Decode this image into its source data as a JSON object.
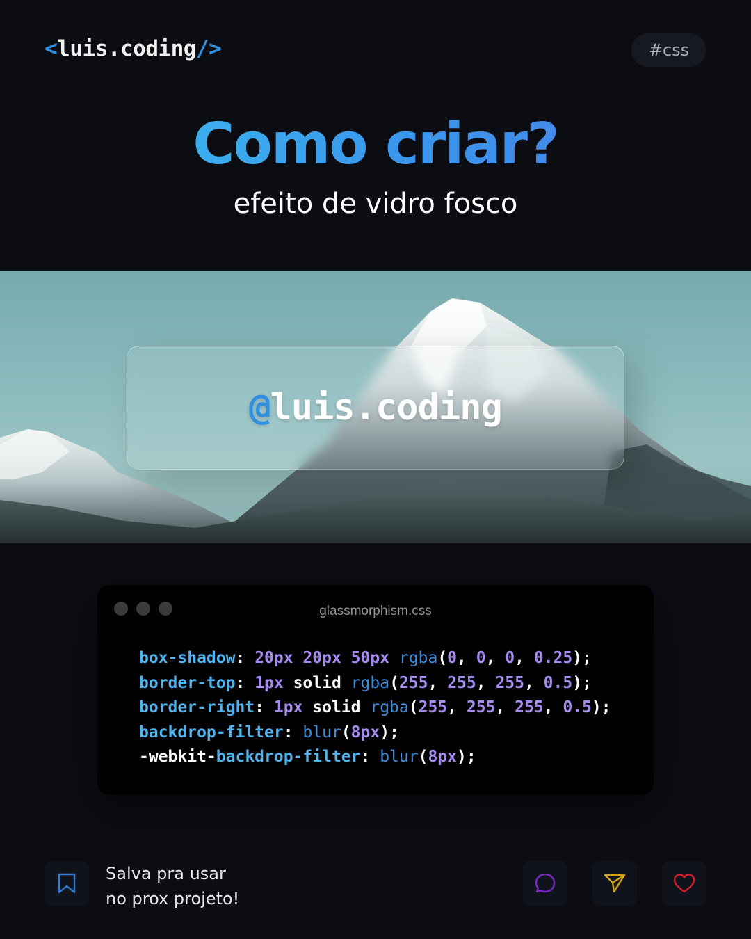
{
  "brand": {
    "open": "<",
    "name": "luis.coding",
    "slash": "/",
    "close": ">"
  },
  "tag": "#css",
  "headline": "Como criar?",
  "subtitle": "efeito de vidro fosco",
  "hero": {
    "at": "@",
    "handle": "luis.coding"
  },
  "code_window": {
    "filename": "glassmorphism.css",
    "lines": [
      [
        {
          "t": "box-shadow",
          "c": "prop"
        },
        {
          "t": ": ",
          "c": "plain"
        },
        {
          "t": "20px 20px 50px",
          "c": "num"
        },
        {
          "t": " ",
          "c": "plain"
        },
        {
          "t": "rgba",
          "c": "fn"
        },
        {
          "t": "(",
          "c": "plain"
        },
        {
          "t": "0",
          "c": "num"
        },
        {
          "t": ", ",
          "c": "plain"
        },
        {
          "t": "0",
          "c": "num"
        },
        {
          "t": ", ",
          "c": "plain"
        },
        {
          "t": "0",
          "c": "num"
        },
        {
          "t": ", ",
          "c": "plain"
        },
        {
          "t": "0.25",
          "c": "num"
        },
        {
          "t": ");",
          "c": "plain"
        }
      ],
      [
        {
          "t": "border-top",
          "c": "prop"
        },
        {
          "t": ": ",
          "c": "plain"
        },
        {
          "t": "1px",
          "c": "num"
        },
        {
          "t": " solid ",
          "c": "plain"
        },
        {
          "t": "rgba",
          "c": "fn"
        },
        {
          "t": "(",
          "c": "plain"
        },
        {
          "t": "255",
          "c": "num"
        },
        {
          "t": ", ",
          "c": "plain"
        },
        {
          "t": "255",
          "c": "num"
        },
        {
          "t": ", ",
          "c": "plain"
        },
        {
          "t": "255",
          "c": "num"
        },
        {
          "t": ", ",
          "c": "plain"
        },
        {
          "t": "0.5",
          "c": "num"
        },
        {
          "t": ");",
          "c": "plain"
        }
      ],
      [
        {
          "t": "border-right",
          "c": "prop"
        },
        {
          "t": ": ",
          "c": "plain"
        },
        {
          "t": "1px",
          "c": "num"
        },
        {
          "t": " solid ",
          "c": "plain"
        },
        {
          "t": "rgba",
          "c": "fn"
        },
        {
          "t": "(",
          "c": "plain"
        },
        {
          "t": "255",
          "c": "num"
        },
        {
          "t": ", ",
          "c": "plain"
        },
        {
          "t": "255",
          "c": "num"
        },
        {
          "t": ", ",
          "c": "plain"
        },
        {
          "t": "255",
          "c": "num"
        },
        {
          "t": ", ",
          "c": "plain"
        },
        {
          "t": "0.5",
          "c": "num"
        },
        {
          "t": ");",
          "c": "plain"
        }
      ],
      [
        {
          "t": "backdrop-filter",
          "c": "prop"
        },
        {
          "t": ": ",
          "c": "plain"
        },
        {
          "t": "blur",
          "c": "fn"
        },
        {
          "t": "(",
          "c": "plain"
        },
        {
          "t": "8px",
          "c": "num"
        },
        {
          "t": ");",
          "c": "plain"
        }
      ],
      [
        {
          "t": "-webkit-",
          "c": "plain"
        },
        {
          "t": "backdrop-filter",
          "c": "prop"
        },
        {
          "t": ": ",
          "c": "plain"
        },
        {
          "t": "blur",
          "c": "fn"
        },
        {
          "t": "(",
          "c": "plain"
        },
        {
          "t": "8px",
          "c": "num"
        },
        {
          "t": ");",
          "c": "plain"
        }
      ]
    ]
  },
  "footer": {
    "save_line1": "Salva pra usar",
    "save_line2": "no prox projeto!",
    "icons": {
      "bookmark": "bookmark-icon",
      "comment": "comment-icon",
      "share": "send-icon",
      "like": "heart-icon"
    }
  },
  "colors": {
    "accent": "#2f8fe0",
    "bookmark": "#2f7dd6",
    "comment": "#7a26c9",
    "share": "#d1a21a",
    "like": "#d51d2a"
  }
}
